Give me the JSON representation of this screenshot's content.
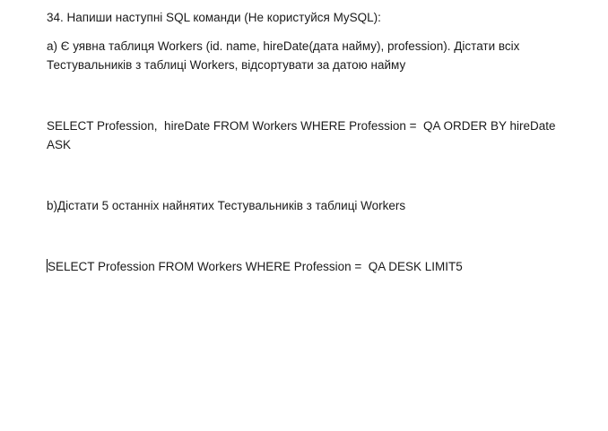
{
  "document": {
    "heading": "34. Напиши наступні SQL команди (Не користуйся MySQL):",
    "task_a_line1": "a) Є уявна таблиця Workers (id. name, hireDate(дата найму), profession). Дістати всіх",
    "task_a_line2": "Тестувальників з таблиці Workers, відсортувати за датою найму",
    "answer_a_line1": "SELECT Profession,  hireDate FROM Workers WHERE Profession =  QA ORDER BY hireDate",
    "answer_a_line2": "ASK",
    "task_b": "b)Дістати 5 останніх найнятих Тестувальників з таблиці Workers",
    "answer_b": "SELECT Profession FROM Workers WHERE Profession =  QA DESK LIMIT5"
  }
}
